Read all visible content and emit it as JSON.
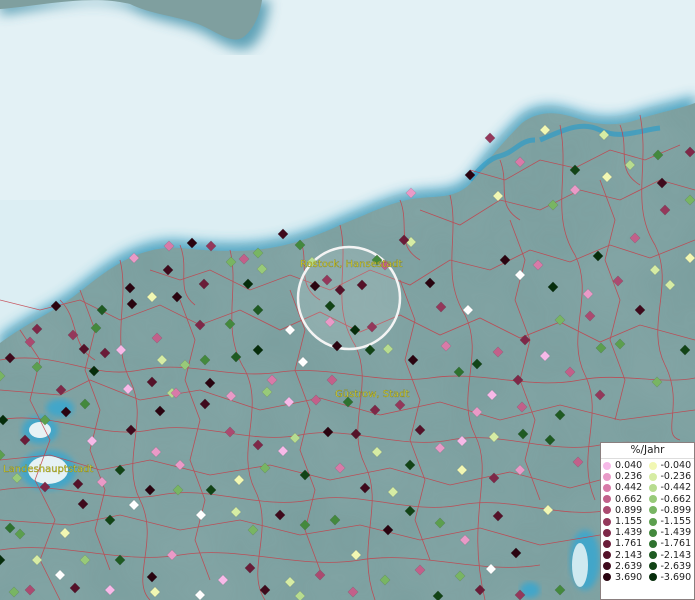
{
  "map": {
    "labels": {
      "rostock": "Rostock, Hansestadt",
      "guestrow": "Güstrow, Stadt",
      "landeshauptstadt": "Landeshauptstadt"
    }
  },
  "legend": {
    "title": "%/Jahr",
    "positive": [
      {
        "value": "0.040",
        "color": "#f7b9e8"
      },
      {
        "value": "0.236",
        "color": "#e99ac7"
      },
      {
        "value": "0.442",
        "color": "#d87aa8"
      },
      {
        "value": "0.662",
        "color": "#c2608a"
      },
      {
        "value": "0.899",
        "color": "#ab4a70"
      },
      {
        "value": "1.155",
        "color": "#94385b"
      },
      {
        "value": "1.439",
        "color": "#7e2848"
      },
      {
        "value": "1.761",
        "color": "#6a1c38"
      },
      {
        "value": "2.143",
        "color": "#551229"
      },
      {
        "value": "2.639",
        "color": "#3f0a1c"
      },
      {
        "value": "3.690",
        "color": "#2a0410"
      }
    ],
    "negative": [
      {
        "value": "-0.040",
        "color": "#f1f7b3"
      },
      {
        "value": "-0.236",
        "color": "#d6eca4"
      },
      {
        "value": "-0.442",
        "color": "#b7dc8f"
      },
      {
        "value": "-0.662",
        "color": "#98ca79"
      },
      {
        "value": "-0.899",
        "color": "#78b563"
      },
      {
        "value": "-1.155",
        "color": "#5c9f4e"
      },
      {
        "value": "-1.439",
        "color": "#44893d"
      },
      {
        "value": "-1.761",
        "color": "#2f722f"
      },
      {
        "value": "-2.143",
        "color": "#1f5b22"
      },
      {
        "value": "-2.639",
        "color": "#124416"
      },
      {
        "value": "-3.690",
        "color": "#062d0b"
      }
    ],
    "special": {
      "white": "#ffffff"
    }
  }
}
